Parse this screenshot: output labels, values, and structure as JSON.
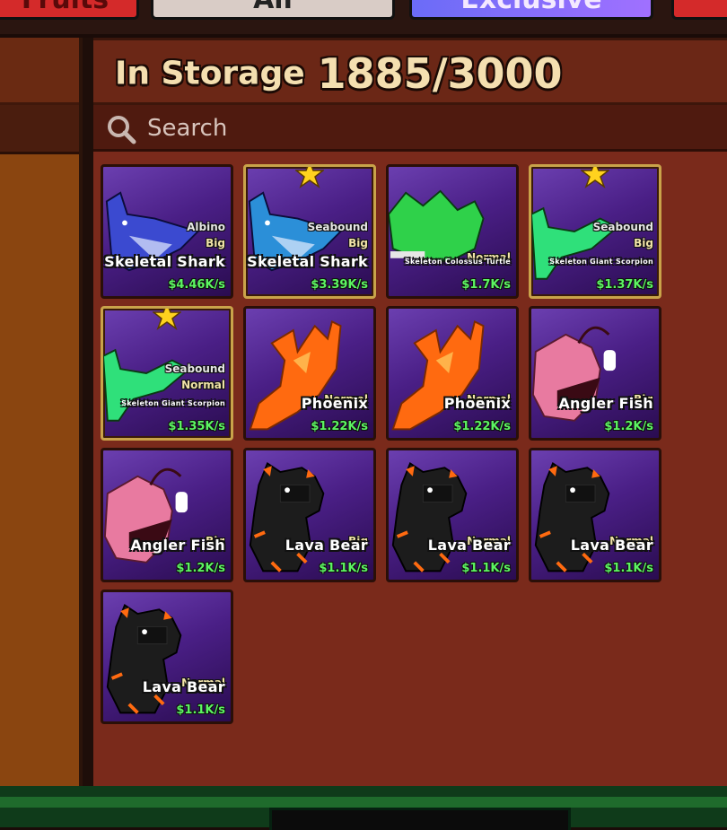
{
  "tabs": {
    "fruits": "Fruits",
    "all": "All",
    "exclusive": "Exclusive"
  },
  "storage": {
    "label": "In Storage",
    "count": "1885/3000"
  },
  "search": {
    "placeholder": "Search"
  },
  "pets": [
    {
      "variant": "Albino",
      "size": "Big",
      "name": "Skeletal Shark",
      "rate": "$4.46K/s",
      "favorite": false,
      "art": "shark",
      "color": "#3b4ad0"
    },
    {
      "variant": "Seabound",
      "size": "Big",
      "name": "Skeletal Shark",
      "rate": "$3.39K/s",
      "favorite": true,
      "art": "shark",
      "color": "#2b8fd8"
    },
    {
      "variant": "",
      "size": "Normal",
      "name": "Skeleton Colossus Turtle",
      "rate": "$1.7K/s",
      "favorite": false,
      "art": "turtle",
      "color": "#2fd14a"
    },
    {
      "variant": "Seabound",
      "size": "Big",
      "name": "Skeleton Giant Scorpion",
      "rate": "$1.37K/s",
      "favorite": true,
      "art": "scorpion",
      "color": "#2fe07a"
    },
    {
      "variant": "Seabound",
      "size": "Normal",
      "name": "Skeleton Giant Scorpion",
      "rate": "$1.35K/s",
      "favorite": true,
      "art": "scorpion",
      "color": "#2fe07a"
    },
    {
      "variant": "",
      "size": "Normal",
      "name": "Phoenix",
      "rate": "$1.22K/s",
      "favorite": false,
      "art": "phoenix",
      "color": "#ff6a10"
    },
    {
      "variant": "",
      "size": "Normal",
      "name": "Phoenix",
      "rate": "$1.22K/s",
      "favorite": false,
      "art": "phoenix",
      "color": "#ff6a10"
    },
    {
      "variant": "",
      "size": "Big",
      "name": "Angler Fish",
      "rate": "$1.2K/s",
      "favorite": false,
      "art": "angler",
      "color": "#e87aa0"
    },
    {
      "variant": "",
      "size": "Big",
      "name": "Angler Fish",
      "rate": "$1.2K/s",
      "favorite": false,
      "art": "angler",
      "color": "#e87aa0"
    },
    {
      "variant": "",
      "size": "Big",
      "name": "Lava Bear",
      "rate": "$1.1K/s",
      "favorite": false,
      "art": "bear",
      "color": "#1c1c1c"
    },
    {
      "variant": "",
      "size": "Normal",
      "name": "Lava Bear",
      "rate": "$1.1K/s",
      "favorite": false,
      "art": "bear",
      "color": "#1c1c1c"
    },
    {
      "variant": "",
      "size": "Normal",
      "name": "Lava Bear",
      "rate": "$1.1K/s",
      "favorite": false,
      "art": "bear",
      "color": "#1c1c1c"
    },
    {
      "variant": "",
      "size": "Normal",
      "name": "Lava Bear",
      "rate": "$1.1K/s",
      "favorite": false,
      "art": "bear",
      "color": "#1c1c1c"
    }
  ],
  "colors": {
    "card_bg": "#4a1f86",
    "rate_green": "#5cf562",
    "favorite_border": "#c9a34a",
    "panel": "#7a2a1b"
  }
}
